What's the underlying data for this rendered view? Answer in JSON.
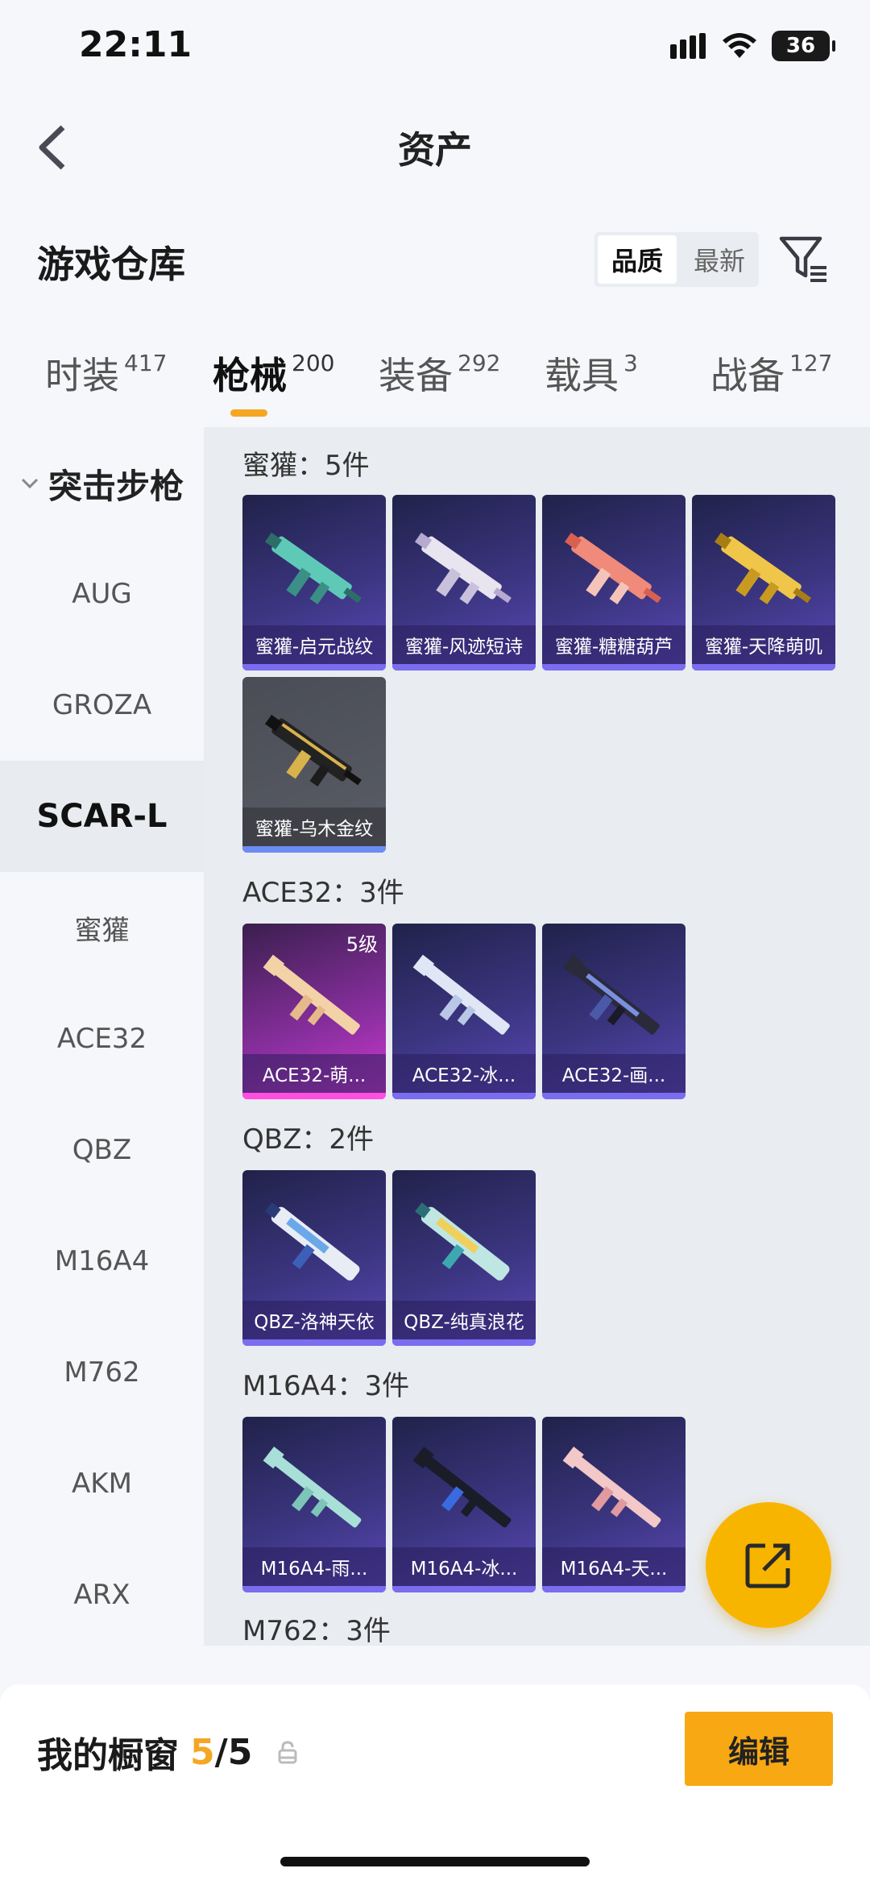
{
  "status": {
    "time": "22:11",
    "battery": "36"
  },
  "nav": {
    "title": "资产"
  },
  "warehouse": {
    "title": "游戏仓库",
    "sort_options": [
      "品质",
      "最新"
    ]
  },
  "tabs": [
    {
      "label": "时装",
      "count": "417"
    },
    {
      "label": "枪械",
      "count": "200"
    },
    {
      "label": "装备",
      "count": "292"
    },
    {
      "label": "载具",
      "count": "3"
    },
    {
      "label": "战备",
      "count": "127"
    }
  ],
  "sidebar": {
    "group": "突击步枪",
    "items": [
      "AUG",
      "GROZA",
      "SCAR-L",
      "蜜獾",
      "ACE32",
      "QBZ",
      "M16A4",
      "M762",
      "AKM",
      "ARX"
    ],
    "selected": "SCAR-L"
  },
  "sections": [
    {
      "title": "蜜獾：5件",
      "items": [
        "蜜獾-启元战纹",
        "蜜獾-风迹短诗",
        "蜜獾-糖糖葫芦",
        "蜜獾-天降萌叽",
        "蜜獾-乌木金纹"
      ]
    },
    {
      "title": "ACE32：3件",
      "items": [
        "ACE32-萌...",
        "ACE32-冰...",
        "ACE32-画..."
      ],
      "level_badge": "5级"
    },
    {
      "title": "QBZ：2件",
      "items": [
        "QBZ-洛神天依",
        "QBZ-纯真浪花"
      ]
    },
    {
      "title": "M16A4：3件",
      "items": [
        "M16A4-雨...",
        "M16A4-冰...",
        "M16A4-天..."
      ]
    },
    {
      "title": "M762：3件",
      "items": []
    }
  ],
  "showcase": {
    "label": "我的橱窗",
    "count": "5",
    "total": "/5",
    "edit_label": "编辑"
  },
  "colors": {
    "accent": "#f5a623",
    "card_purple": "#3b3580",
    "fab": "#f7b500"
  }
}
